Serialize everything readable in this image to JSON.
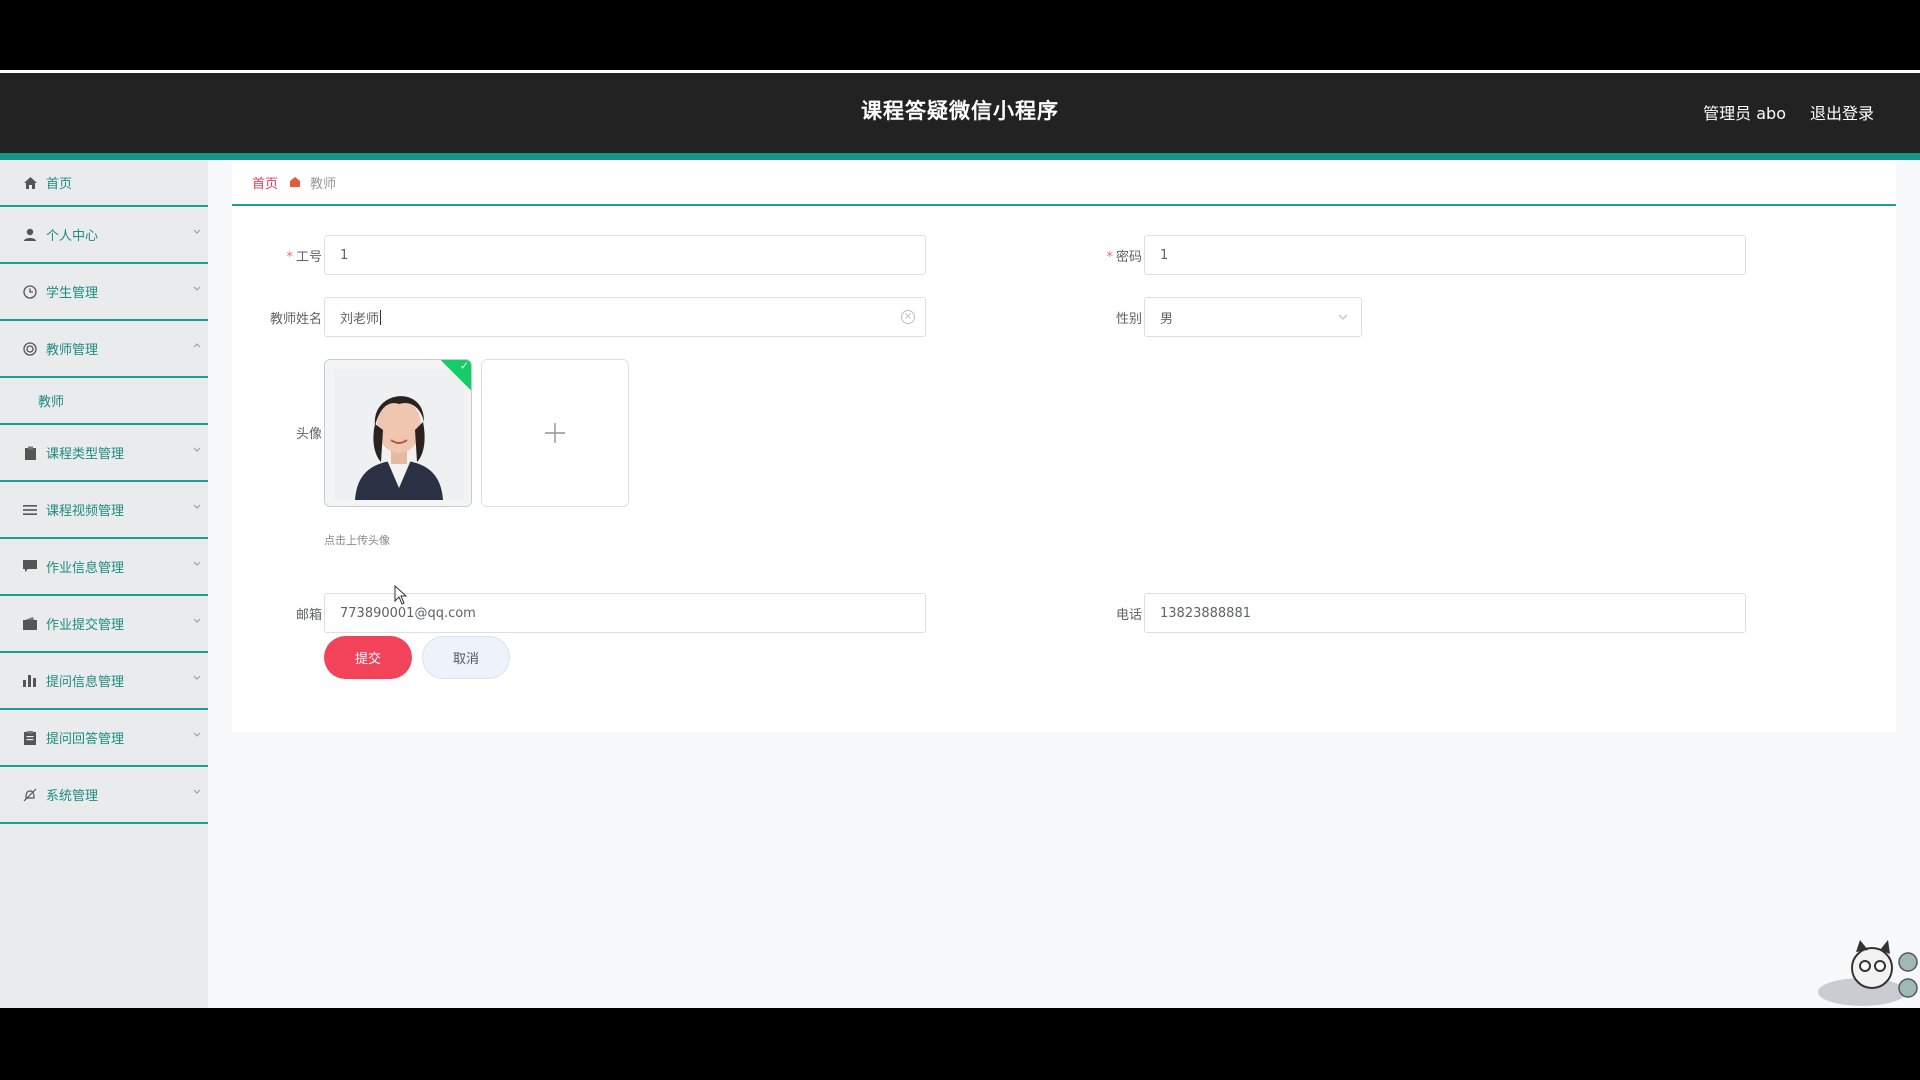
{
  "header": {
    "title": "课程答疑微信小程序",
    "user": "管理员 abo",
    "logout": "退出登录"
  },
  "sidebar": {
    "items": [
      {
        "label": "首页",
        "icon": "home-icon"
      },
      {
        "label": "个人中心",
        "icon": "user-icon"
      },
      {
        "label": "学生管理",
        "icon": "clock-icon"
      },
      {
        "label": "教师管理",
        "icon": "circle-icon",
        "expanded": true,
        "children": [
          "教师"
        ]
      },
      {
        "label": "课程类型管理",
        "icon": "clipboard-icon"
      },
      {
        "label": "课程视频管理",
        "icon": "list-icon"
      },
      {
        "label": "作业信息管理",
        "icon": "chat-icon"
      },
      {
        "label": "作业提交管理",
        "icon": "wallet-icon"
      },
      {
        "label": "提问信息管理",
        "icon": "bar-chart-icon"
      },
      {
        "label": "提问回答管理",
        "icon": "document-icon"
      },
      {
        "label": "系统管理",
        "icon": "bell-off-icon"
      }
    ]
  },
  "breadcrumb": {
    "home": "首页",
    "current": "教师"
  },
  "form": {
    "gonghao": {
      "label": "工号",
      "value": "1",
      "required": true
    },
    "mima": {
      "label": "密码",
      "value": "1",
      "required": true
    },
    "name": {
      "label": "教师姓名",
      "value": "刘老师"
    },
    "gender": {
      "label": "性别",
      "value": "男"
    },
    "avatar": {
      "label": "头像",
      "hint": "点击上传头像"
    },
    "email": {
      "label": "邮箱",
      "value": "773890001@qq.com"
    },
    "phone": {
      "label": "电话",
      "value": "13823888881"
    },
    "submit": "提交",
    "cancel": "取消"
  },
  "colors": {
    "accent": "#15958a",
    "danger": "#f2435a",
    "header": "#222222"
  }
}
